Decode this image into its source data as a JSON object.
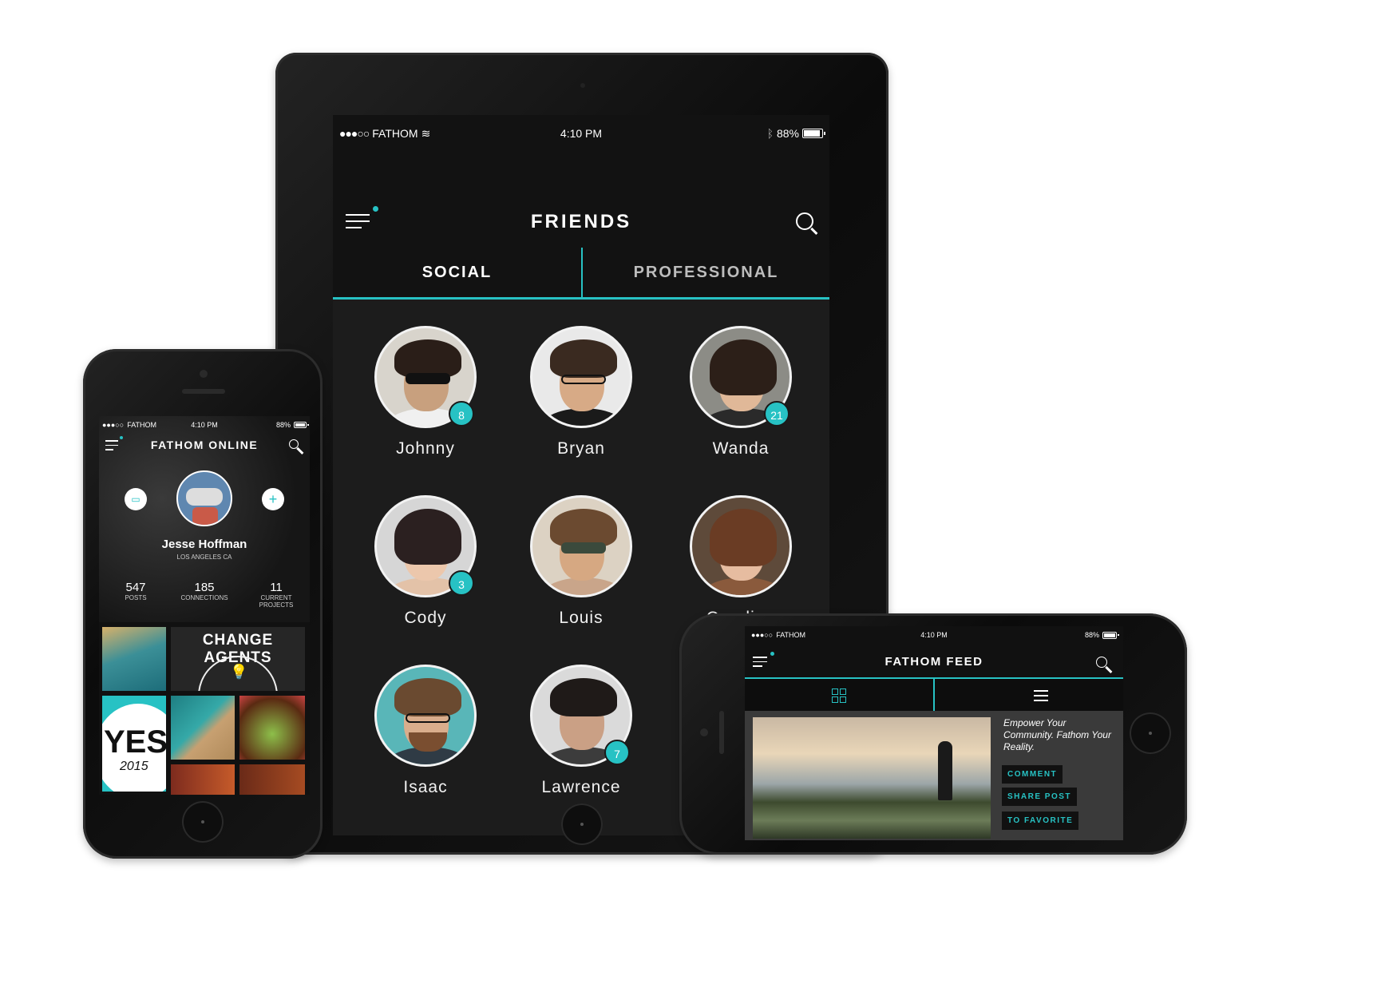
{
  "tablet": {
    "status": {
      "carrier": "FATHOM",
      "time": "4:10 PM",
      "battery": "88%",
      "battery_level": 0.88
    },
    "title": "FRIENDS",
    "tabs": [
      {
        "label": "SOCIAL",
        "active": true
      },
      {
        "label": "PROFESSIONAL",
        "active": false
      }
    ],
    "friends": [
      {
        "name": "Johnny",
        "badge": "8"
      },
      {
        "name": "Bryan",
        "badge": ""
      },
      {
        "name": "Wanda",
        "badge": "21"
      },
      {
        "name": "Cody",
        "badge": "3"
      },
      {
        "name": "Louis",
        "badge": ""
      },
      {
        "name": "Caroline",
        "badge": ""
      },
      {
        "name": "Isaac",
        "badge": ""
      },
      {
        "name": "Lawrence",
        "badge": "7"
      }
    ],
    "icons": {
      "menu": "menu-icon",
      "search": "search-icon"
    }
  },
  "phone": {
    "status": {
      "carrier": "FATHOM",
      "time": "4:10 PM",
      "battery": "88%",
      "battery_level": 0.88
    },
    "title": "FATHOM ONLINE",
    "profile": {
      "name": "Jesse Hoffman",
      "location": "LOS ANGELES CA"
    },
    "stats": [
      {
        "value": "547",
        "label": "POSTS"
      },
      {
        "value": "185",
        "label": "CONNECTIONS"
      },
      {
        "value": "11",
        "label": "CURRENT PROJECTS"
      }
    ],
    "tiles": {
      "change_agents": "CHANGE AGENTS",
      "yes": "YES",
      "yes_year": "2015"
    }
  },
  "landscape": {
    "status": {
      "carrier": "FATHOM",
      "time": "4:10 PM",
      "battery": "88%",
      "battery_level": 0.88
    },
    "title": "FATHOM FEED",
    "caption": "Empower Your Community. Fathom Your Reality.",
    "actions": [
      "COMMENT",
      "SHARE POST",
      "TO FAVORITE"
    ]
  },
  "colors": {
    "accent": "#27c2c4",
    "screen": "#1a1a1a",
    "bezel": "#0b0b0b"
  }
}
